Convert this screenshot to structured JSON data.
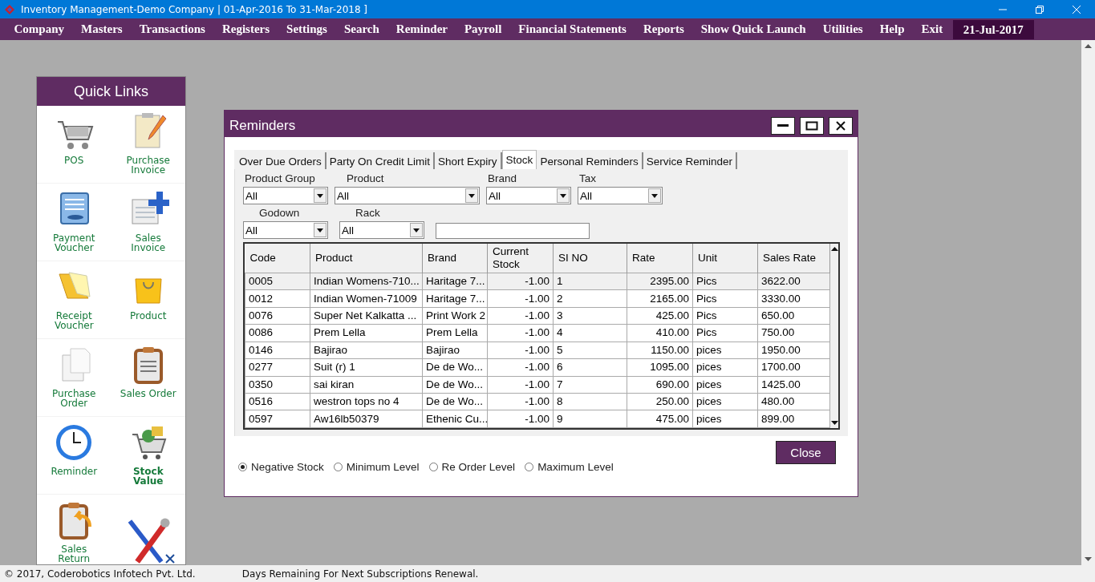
{
  "window": {
    "title": "Inventory Management-Demo Company | 01-Apr-2016 To 31-Mar-2018 ]"
  },
  "menu": {
    "items": [
      "Company",
      "Masters",
      "Transactions",
      "Registers",
      "Settings",
      "Search",
      "Reminder",
      "Payroll",
      "Financial Statements",
      "Reports",
      "Show Quick Launch",
      "Utilities",
      "Help",
      "Exit"
    ],
    "date": "21-Jul-2017"
  },
  "quick_links": {
    "title": "Quick Links",
    "items": [
      {
        "label": "POS"
      },
      {
        "label": "Purchase Invoice"
      },
      {
        "label": "Payment Voucher"
      },
      {
        "label": "Sales Invoice"
      },
      {
        "label": "Receipt Voucher"
      },
      {
        "label": "Product"
      },
      {
        "label": "Purchase Order"
      },
      {
        "label": "Sales Order"
      },
      {
        "label": "Reminder"
      },
      {
        "label": "Stock Value",
        "bold": true
      },
      {
        "label": "Sales Return"
      }
    ]
  },
  "reminders": {
    "title": "Reminders",
    "tabs": [
      {
        "label": "Over Due Orders",
        "selected": false
      },
      {
        "label": "Party On Credit Limit",
        "selected": false
      },
      {
        "label": "Short Expiry",
        "selected": false
      },
      {
        "label": "Stock",
        "selected": true
      },
      {
        "label": "Personal Reminders",
        "selected": false
      },
      {
        "label": "Service Reminder",
        "selected": false
      }
    ],
    "filters": [
      [
        {
          "label": "Product Group",
          "value": "All"
        },
        {
          "label": "Product",
          "value": "All"
        },
        {
          "label": "Brand",
          "value": "All"
        },
        {
          "label": "Tax",
          "value": "All"
        }
      ],
      [
        {
          "label": "Godown",
          "value": "All"
        },
        {
          "label": "Rack",
          "value": "All"
        }
      ]
    ],
    "table": {
      "columns": [
        "Code",
        "Product",
        "Brand",
        "Current Stock",
        "SI NO",
        "Rate",
        "Unit",
        "Sales Rate"
      ],
      "rows": [
        {
          "selected": true,
          "cells": [
            "0005",
            "Indian Womens-710...",
            "Haritage 7...",
            "-1.00",
            "1",
            "2395.00",
            "Pics",
            "3622.00"
          ]
        },
        {
          "selected": false,
          "cells": [
            "0012",
            "Indian Women-71009",
            "Haritage 7...",
            "-1.00",
            "2",
            "2165.00",
            "Pics",
            "3330.00"
          ]
        },
        {
          "selected": false,
          "cells": [
            "0076",
            "Super Net Kalkatta ...",
            "Print Work 2",
            "-1.00",
            "3",
            "425.00",
            "Pics",
            "650.00"
          ]
        },
        {
          "selected": false,
          "cells": [
            "0086",
            "Prem Lella",
            "Prem Lella",
            "-1.00",
            "4",
            "410.00",
            "Pics",
            "750.00"
          ]
        },
        {
          "selected": false,
          "cells": [
            "0146",
            "Bajirao",
            "Bajirao",
            "-1.00",
            "5",
            "1150.00",
            "pices",
            "1950.00"
          ]
        },
        {
          "selected": false,
          "cells": [
            "0277",
            "Suit (r) 1",
            "De de Wo...",
            "-1.00",
            "6",
            "1095.00",
            "pices",
            "1700.00"
          ]
        },
        {
          "selected": false,
          "cells": [
            "0350",
            "sai kiran",
            "De de Wo...",
            "-1.00",
            "7",
            "690.00",
            "pices",
            "1425.00"
          ]
        },
        {
          "selected": false,
          "cells": [
            "0516",
            "westron tops no 4",
            "De de Wo...",
            "-1.00",
            "8",
            "250.00",
            "pices",
            "480.00"
          ]
        },
        {
          "selected": false,
          "cells": [
            "0597",
            "Aw16lb50379",
            "Ethenic Cu...",
            "-1.00",
            "9",
            "475.00",
            "pices",
            "899.00"
          ]
        }
      ]
    },
    "close_button": "Close",
    "radios": [
      {
        "label": "Negative Stock",
        "selected": true
      },
      {
        "label": "Minimum Level",
        "selected": false
      },
      {
        "label": "Re Order Level",
        "selected": false
      },
      {
        "label": "Maximum Level",
        "selected": false
      }
    ]
  },
  "status_bar": {
    "copyright": "© 2017, Coderobotics Infotech Pvt. Ltd.",
    "message": "Days Remaining For Next Subscriptions Renewal."
  }
}
